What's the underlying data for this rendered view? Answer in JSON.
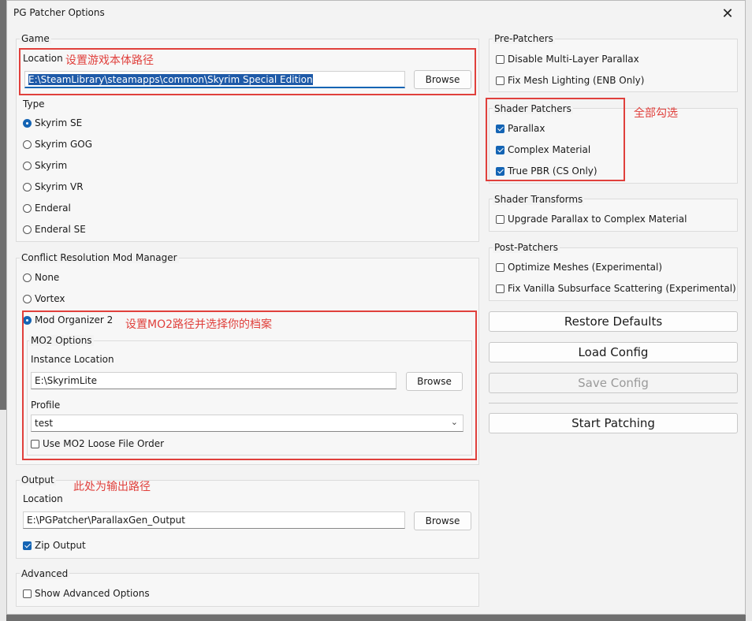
{
  "window": {
    "title": "PG Patcher Options",
    "close_glyph": "✕"
  },
  "game": {
    "title": "Game",
    "location_label": "Location",
    "location_value": "E:\\SteamLibrary\\steamapps\\common\\Skyrim Special Edition",
    "browse": "Browse",
    "type_label": "Type",
    "types": [
      {
        "label": "Skyrim SE",
        "selected": true
      },
      {
        "label": "Skyrim GOG",
        "selected": false
      },
      {
        "label": "Skyrim",
        "selected": false
      },
      {
        "label": "Skyrim VR",
        "selected": false
      },
      {
        "label": "Enderal",
        "selected": false
      },
      {
        "label": "Enderal SE",
        "selected": false
      }
    ]
  },
  "conflict": {
    "title": "Conflict Resolution Mod Manager",
    "options": [
      {
        "label": "None",
        "selected": false
      },
      {
        "label": "Vortex",
        "selected": false
      },
      {
        "label": "Mod Organizer 2",
        "selected": true
      }
    ],
    "mo2": {
      "title": "MO2 Options",
      "instance_label": "Instance Location",
      "instance_value": "E:\\SkyrimLite",
      "browse": "Browse",
      "profile_label": "Profile",
      "profile_value": "test",
      "loose_file_order": "Use MO2 Loose File Order"
    }
  },
  "output": {
    "title": "Output",
    "location_label": "Location",
    "location_value": "E:\\PGPatcher\\ParallaxGen_Output",
    "browse": "Browse",
    "zip": "Zip Output"
  },
  "advanced": {
    "title": "Advanced",
    "show": "Show Advanced Options"
  },
  "pre_patchers": {
    "title": "Pre-Patchers",
    "items": [
      {
        "label": "Disable Multi-Layer Parallax",
        "checked": false
      },
      {
        "label": "Fix Mesh Lighting (ENB Only)",
        "checked": false
      }
    ]
  },
  "shader_patchers": {
    "title": "Shader Patchers",
    "items": [
      {
        "label": "Parallax",
        "checked": true
      },
      {
        "label": "Complex Material",
        "checked": true
      },
      {
        "label": "True PBR (CS Only)",
        "checked": true
      }
    ]
  },
  "shader_transforms": {
    "title": "Shader Transforms",
    "items": [
      {
        "label": "Upgrade Parallax to Complex Material",
        "checked": false
      }
    ]
  },
  "post_patchers": {
    "title": "Post-Patchers",
    "items": [
      {
        "label": "Optimize Meshes (Experimental)",
        "checked": false
      },
      {
        "label": "Fix Vanilla Subsurface Scattering (Experimental)",
        "checked": false
      }
    ]
  },
  "buttons": {
    "restore": "Restore Defaults",
    "load": "Load Config",
    "save": "Save Config",
    "start": "Start Patching"
  },
  "annotations": {
    "game_location": "设置游戏本体路径",
    "shader_all": "全部勾选",
    "mo2": "设置MO2路径并选择你的档案",
    "output": "此处为输出路径"
  },
  "colors": {
    "accent": "#1464b4",
    "annotation": "#e0403c"
  }
}
